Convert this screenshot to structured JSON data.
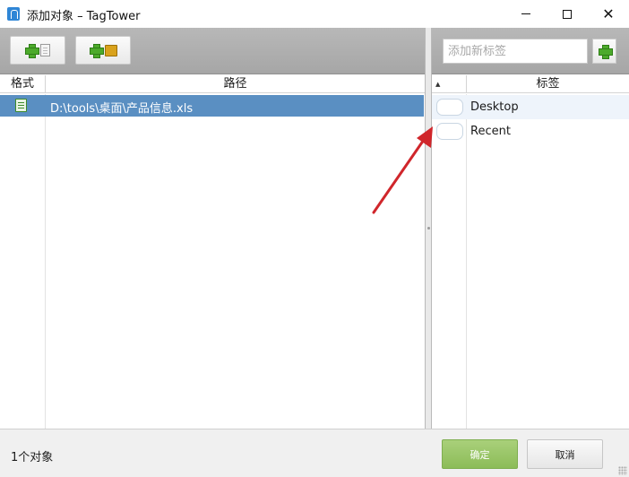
{
  "window": {
    "title": "添加对象 – TagTower"
  },
  "left_pane": {
    "toolbar": {
      "add_file_icon": "plus-document-icon",
      "add_folder_icon": "plus-folder-icon"
    },
    "columns": {
      "format": "格式",
      "path": "路径"
    },
    "rows": [
      {
        "format_icon": "excel-file-icon",
        "path": "D:\\tools\\桌面\\产品信息.xls"
      }
    ]
  },
  "right_pane": {
    "new_tag_placeholder": "添加新标签",
    "sort_indicator": "▲",
    "columns": {
      "tag": "标签"
    },
    "tags": [
      {
        "label": "Desktop",
        "checked": false
      },
      {
        "label": "Recent",
        "checked": false
      }
    ]
  },
  "footer": {
    "status": "1个对象",
    "ok_label": "确定",
    "cancel_label": "取消"
  },
  "colors": {
    "selection": "#5a8fc2",
    "ok_button": "#8cbc58",
    "annotation_arrow": "#d0262b"
  }
}
